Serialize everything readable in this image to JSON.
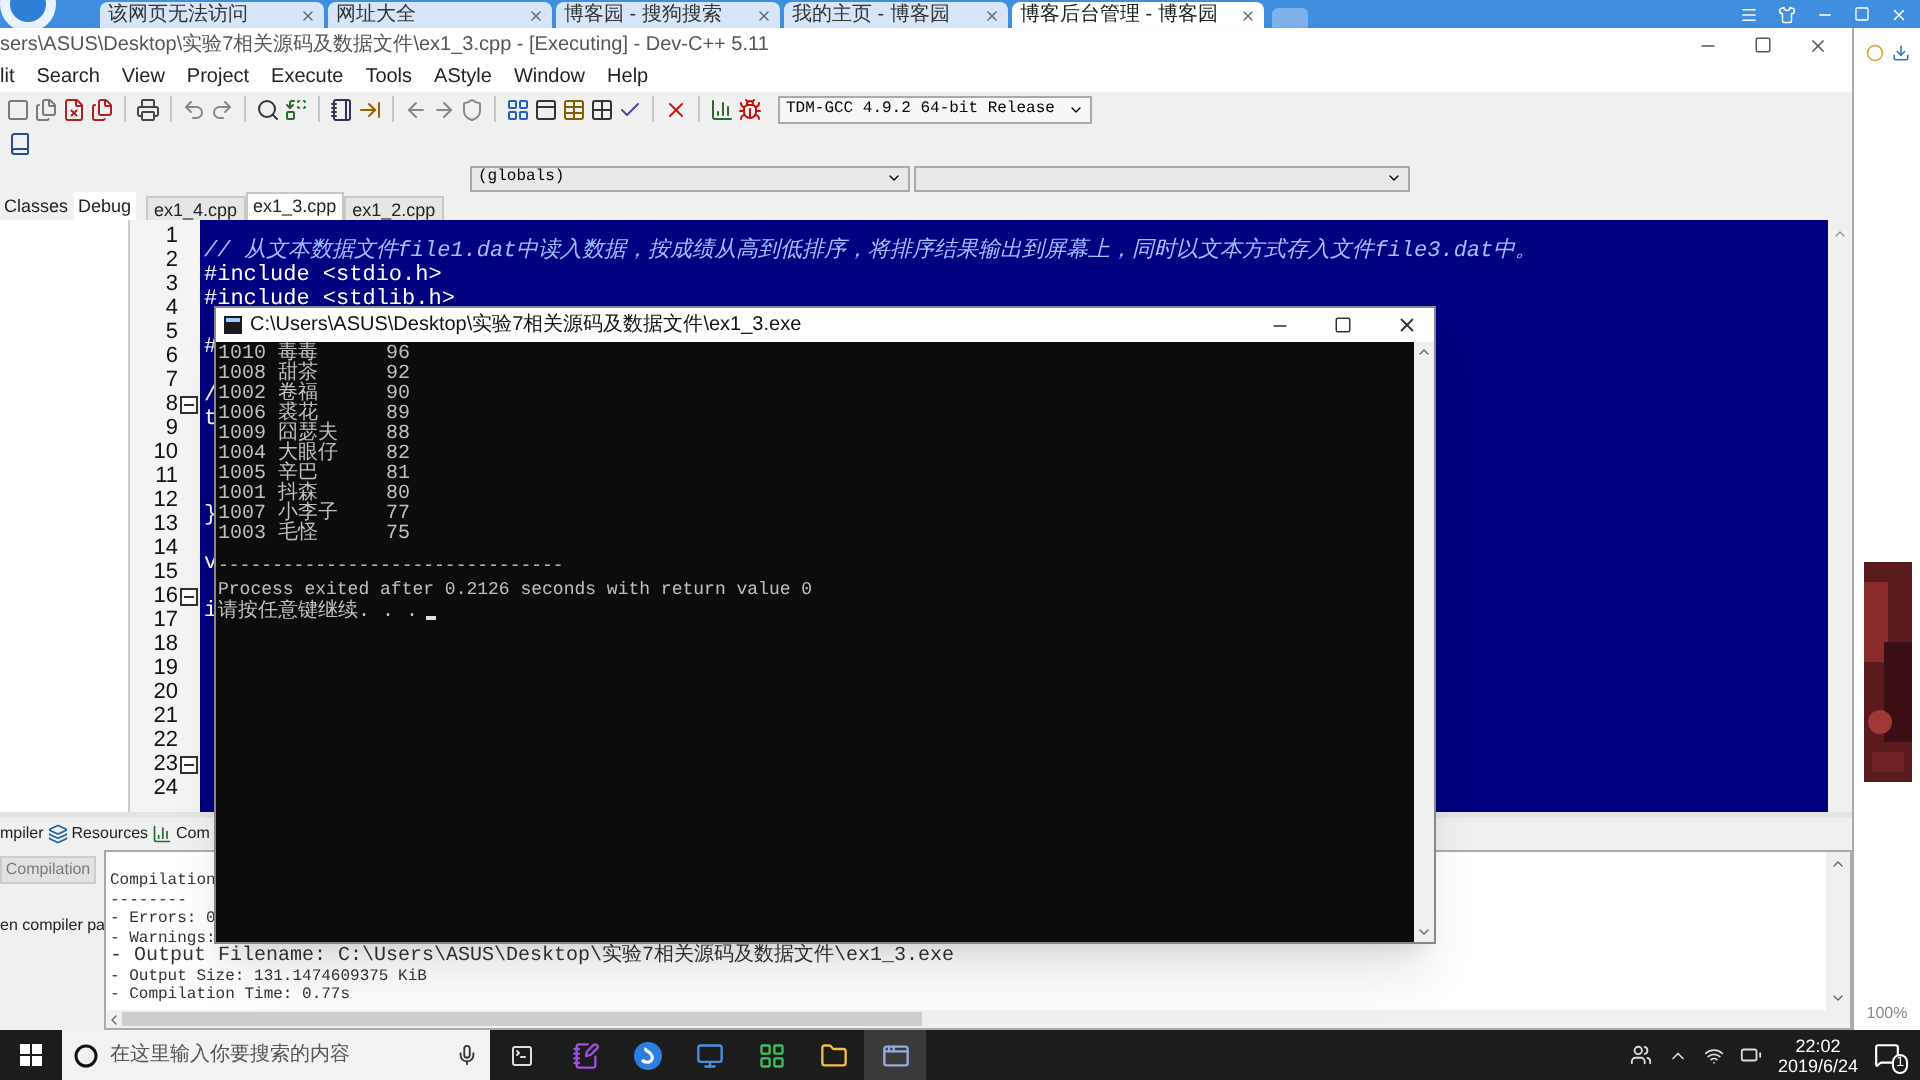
{
  "browser_tabs": [
    {
      "label": "该网页无法访问",
      "selected": false
    },
    {
      "label": "网址大全",
      "selected": false
    },
    {
      "label": "博客园 - 搜狗搜索",
      "selected": false
    },
    {
      "label": "我的主页 - 博客园",
      "selected": false
    },
    {
      "label": "博客后台管理 - 博客园",
      "selected": true
    }
  ],
  "window": {
    "title": "sers\\ASUS\\Desktop\\实验7相关源码及数据文件\\ex1_3.cpp - [Executing] - Dev-C++ 5.11",
    "menu": [
      "lit",
      "Search",
      "View",
      "Project",
      "Execute",
      "Tools",
      "AStyle",
      "Window",
      "Help"
    ],
    "compiler_select": "TDM-GCC 4.9.2 64-bit Release",
    "scope_select": "(globals)"
  },
  "left_panel": {
    "tabs": [
      {
        "label": "Classes",
        "selected": false
      },
      {
        "label": "Debug",
        "selected": true
      }
    ]
  },
  "editor": {
    "tabs": [
      {
        "label": "ex1_4.cpp",
        "selected": false
      },
      {
        "label": "ex1_3.cpp",
        "selected": true
      },
      {
        "label": "ex1_2.cpp",
        "selected": false
      }
    ],
    "lines": [
      {
        "number": "1",
        "text": "// 从文本数据文件file1.dat中读入数据，按成绩从高到低排序，将排序结果输出到屏幕上，同时以文本方式存入文件file3.dat中。",
        "fold": false
      },
      {
        "number": "2",
        "text": "#include <stdio.h>",
        "fold": false
      },
      {
        "number": "3",
        "text": "#include <stdlib.h>",
        "fold": false
      },
      {
        "number": "4",
        "fold": false
      },
      {
        "number": "5",
        "text": "#",
        "fold": false
      },
      {
        "number": "6",
        "fold": false
      },
      {
        "number": "7",
        "text": "/",
        "fold": false
      },
      {
        "number": "8",
        "text": "t",
        "fold": true
      },
      {
        "number": "9",
        "fold": false
      },
      {
        "number": "10",
        "fold": false
      },
      {
        "number": "11",
        "fold": false
      },
      {
        "number": "12",
        "text": "}",
        "fold": false
      },
      {
        "number": "13",
        "fold": false
      },
      {
        "number": "14",
        "text": "v",
        "fold": false
      },
      {
        "number": "15",
        "fold": false
      },
      {
        "number": "16",
        "text": "i",
        "fold": true
      },
      {
        "number": "17",
        "fold": false
      },
      {
        "number": "18",
        "fold": false
      },
      {
        "number": "19",
        "fold": false
      },
      {
        "number": "20",
        "fold": false
      },
      {
        "number": "21",
        "fold": false
      },
      {
        "number": "22",
        "fold": false
      },
      {
        "number": "23",
        "fold": true
      },
      {
        "number": "24",
        "fold": false
      }
    ]
  },
  "bottom_panel": {
    "tabs": [
      {
        "label": "mpiler"
      },
      {
        "label": "Resources"
      },
      {
        "label": "Com"
      }
    ],
    "button": {
      "label": "Compilation",
      "disabled": true
    },
    "side_label": "en compiler pa",
    "log": [
      {
        "text": "Compilation",
        "kind": "plain"
      },
      {
        "text": "--------",
        "kind": "plain"
      },
      {
        "text": "- Errors: 0",
        "kind": "plain"
      },
      {
        "text": "- Warnings:",
        "kind": "plain"
      },
      {
        "text": "- Output Filename: C:\\Users\\ASUS\\Desktop\\实验7相关源码及数据文件\\ex1_3.exe",
        "kind": "path"
      },
      {
        "text": "- Output Size: 131.1474609375 KiB",
        "kind": "plain"
      },
      {
        "text": "- Compilation Time: 0.77s",
        "kind": "plain"
      }
    ]
  },
  "console": {
    "title": "C:\\Users\\ASUS\\Desktop\\实验7相关源码及数据文件\\ex1_3.exe",
    "rows": [
      {
        "id": "1010",
        "name": "毒毒",
        "score": "96"
      },
      {
        "id": "1008",
        "name": "甜茶",
        "score": "92"
      },
      {
        "id": "1002",
        "name": "卷福",
        "score": "90"
      },
      {
        "id": "1006",
        "name": "裘花",
        "score": "89"
      },
      {
        "id": "1009",
        "name": "囧瑟夫",
        "score": "88"
      },
      {
        "id": "1004",
        "name": "大眼仔",
        "score": "82"
      },
      {
        "id": "1005",
        "name": "辛巴",
        "score": "81"
      },
      {
        "id": "1001",
        "name": "抖森",
        "score": "80"
      },
      {
        "id": "1007",
        "name": "小李子",
        "score": "77"
      },
      {
        "id": "1003",
        "name": "毛怪",
        "score": "75"
      }
    ],
    "separator": "--------------------------------",
    "exit_message": "Process exited after 0.2126 seconds with return value 0",
    "prompt": "请按任意键继续. . ."
  },
  "browser_side": {
    "zoom": "100%"
  },
  "taskbar": {
    "search_placeholder": "在这里输入你要搜索的内容",
    "time": "22:02",
    "date": "2019/6/24",
    "notifications": "1"
  }
}
